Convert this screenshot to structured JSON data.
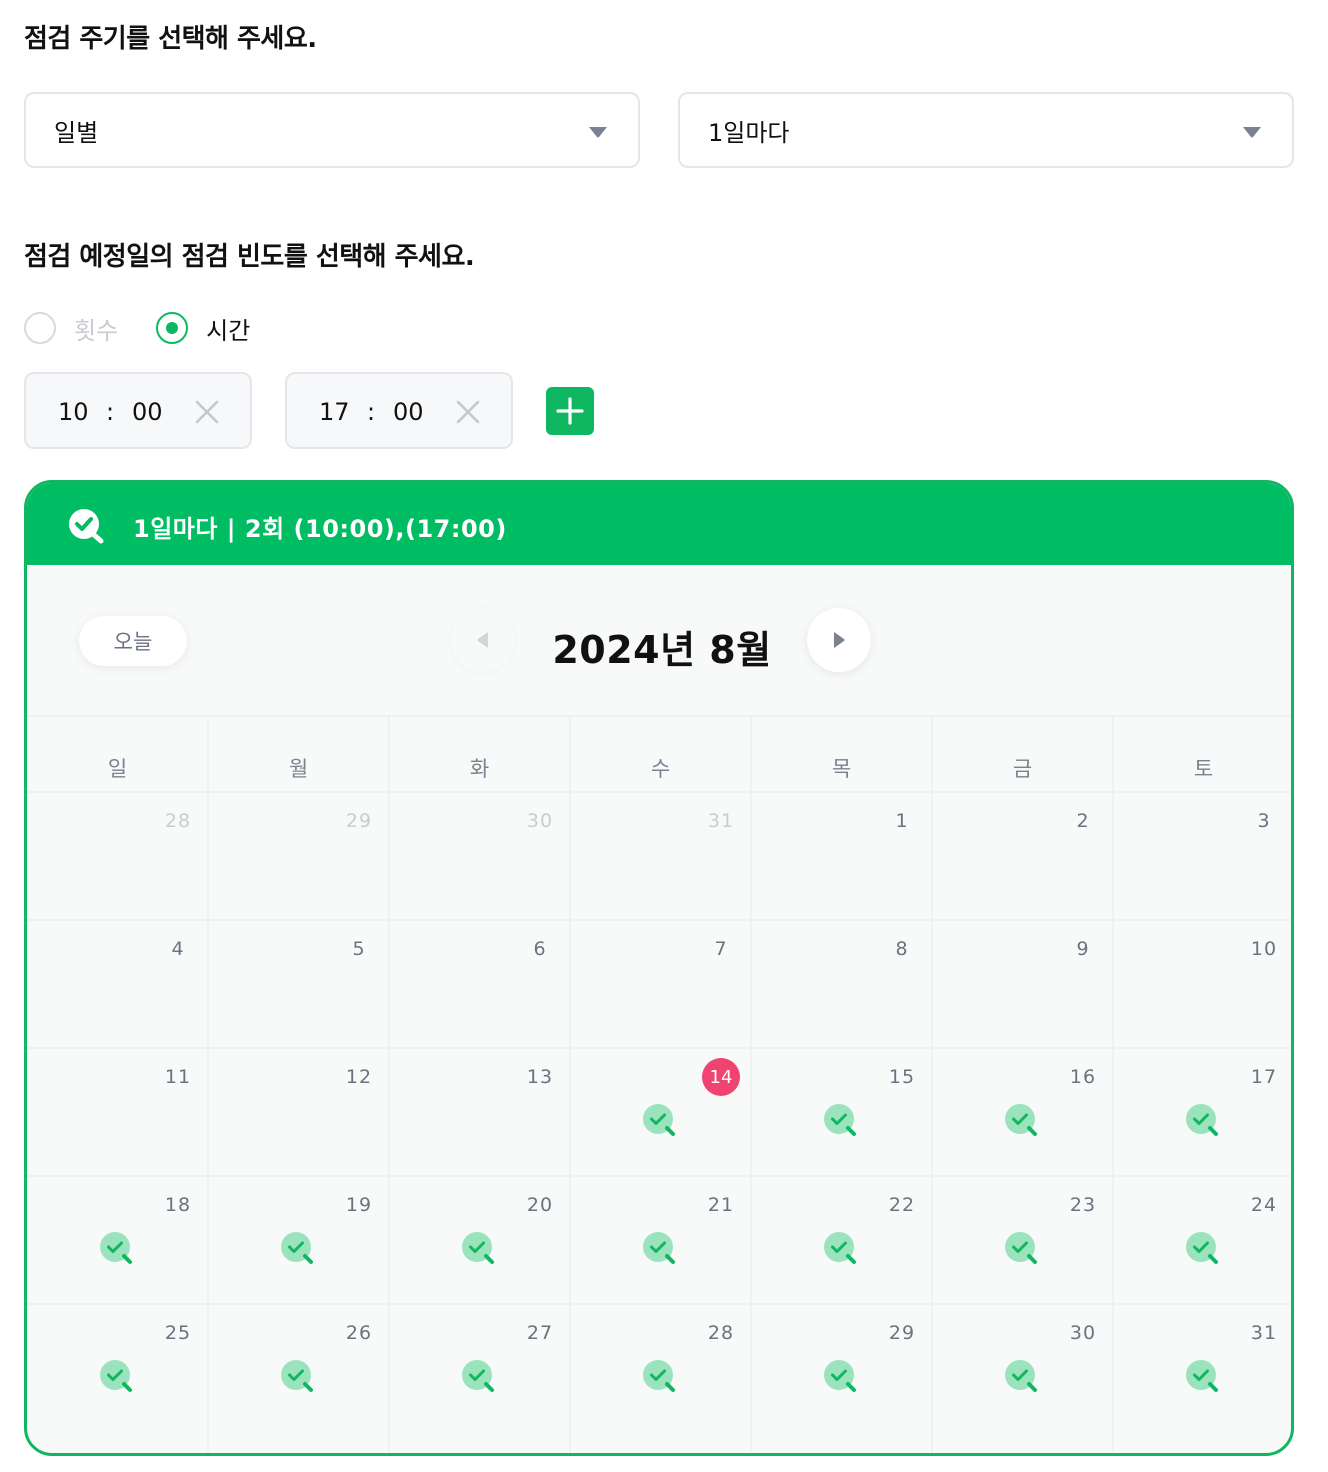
{
  "section1": {
    "title": "점검 주기를 선택해 주세요."
  },
  "period_select": {
    "value": "일별",
    "caret_icon": "caret-down-icon"
  },
  "interval_select": {
    "value": "1일마다",
    "caret_icon": "caret-down-icon"
  },
  "section2": {
    "title": "점검 예정일의 점검 빈도를 선택해 주세요."
  },
  "frequency": {
    "options": [
      {
        "label": "횟수",
        "checked": false
      },
      {
        "label": "시간",
        "checked": true
      }
    ]
  },
  "times": [
    {
      "hour": "10",
      "sep": ":",
      "minute": "00"
    },
    {
      "hour": "17",
      "sep": ":",
      "minute": "00"
    }
  ],
  "add_button": {
    "icon": "plus-icon"
  },
  "calendar": {
    "banner_text": "1일마다 | 2회 (10:00),(17:00)",
    "today_label": "오늘",
    "month_title": "2024년 8월",
    "weekdays": [
      "일",
      "월",
      "화",
      "수",
      "목",
      "금",
      "토"
    ],
    "weeks": [
      [
        "28",
        "29",
        "30",
        "31",
        "1",
        "2",
        "3"
      ],
      [
        "4",
        "5",
        "6",
        "7",
        "8",
        "9",
        "10"
      ],
      [
        "11",
        "12",
        "13",
        "14",
        "15",
        "16",
        "17"
      ],
      [
        "18",
        "19",
        "20",
        "21",
        "22",
        "23",
        "24"
      ],
      [
        "25",
        "26",
        "27",
        "28",
        "29",
        "30",
        "31"
      ]
    ],
    "outside_month": [
      [
        0,
        0
      ],
      [
        0,
        1
      ],
      [
        0,
        2
      ],
      [
        0,
        3
      ]
    ],
    "today": [
      2,
      3
    ],
    "scheduled_from": [
      2,
      3
    ],
    "colors": {
      "accent": "#00bc62",
      "today": "#f0436f",
      "mark_bg": "#9be3bd",
      "mark_fg": "#10b761"
    }
  }
}
